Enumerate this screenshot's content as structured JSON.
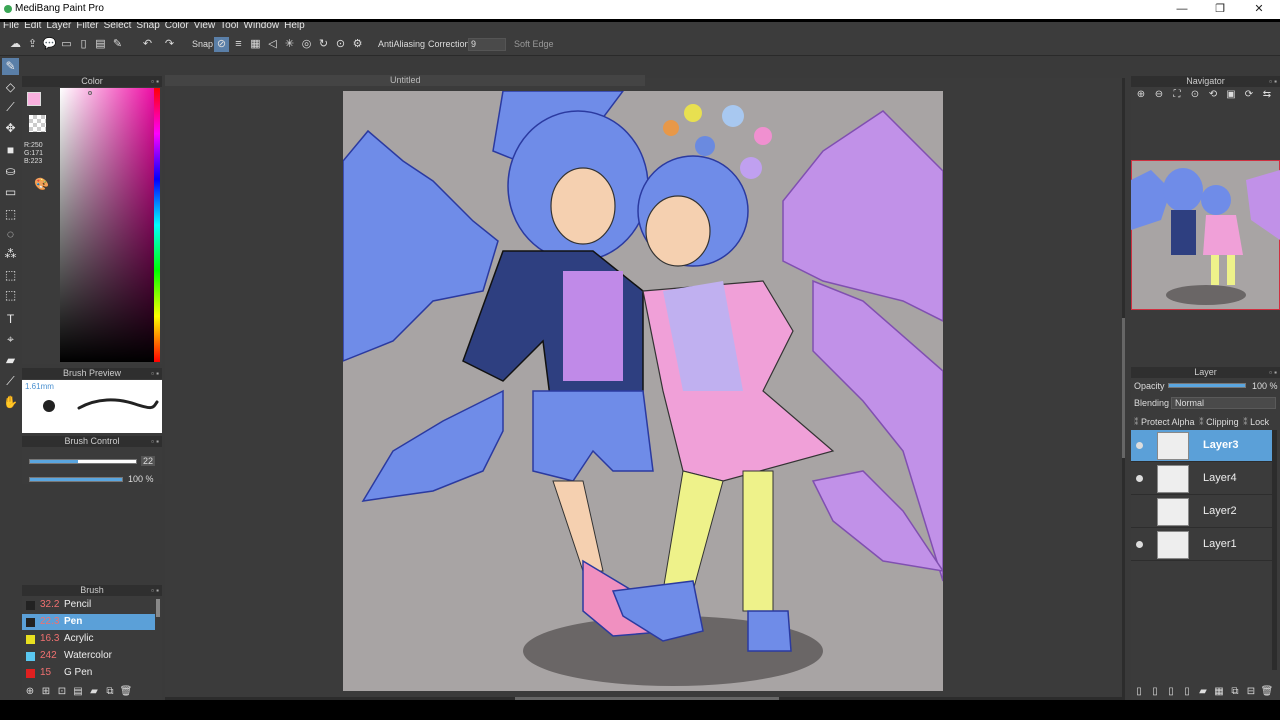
{
  "window": {
    "title": "MediBang Paint Pro",
    "minimize": "—",
    "maximize": "❐",
    "close": "✕"
  },
  "menu": [
    "File",
    "Edit",
    "Layer",
    "Filter",
    "Select",
    "Snap",
    "Color",
    "View",
    "Tool",
    "Window",
    "Help"
  ],
  "toolbar": {
    "snap_label": "Snap",
    "antialiasing_label": "AntiAliasing",
    "correction_label": "Correction",
    "correction_value": "9",
    "soft_edge_label": "Soft Edge"
  },
  "color_panel": {
    "title": "Color",
    "fg_color": "#fab0df",
    "r": "R:250",
    "g": "G:171",
    "b": "B:223"
  },
  "brush_preview": {
    "title": "Brush Preview",
    "size": "1.61mm"
  },
  "brush_control": {
    "title": "Brush Control",
    "size_value": "22",
    "size_fraction": 0.45,
    "opacity_value": "100 %",
    "opacity_fraction": 1.0
  },
  "brush_panel": {
    "title": "Brush",
    "items": [
      {
        "size": "32.2",
        "name": "Pencil",
        "color": "#222222",
        "selected": false
      },
      {
        "size": "22.3",
        "name": "Pen",
        "color": "#222222",
        "selected": true
      },
      {
        "size": "16.3",
        "name": "Acrylic",
        "color": "#e8e020",
        "selected": false
      },
      {
        "size": "242",
        "name": "Watercolor",
        "color": "#5ac8f0",
        "selected": false
      },
      {
        "size": "15",
        "name": "G Pen",
        "color": "#e02020",
        "selected": false
      }
    ]
  },
  "canvas": {
    "document_tab": "Untitled"
  },
  "navigator": {
    "title": "Navigator"
  },
  "layer_panel": {
    "title": "Layer",
    "opacity_label": "Opacity",
    "opacity_value": "100 %",
    "opacity_fraction": 1.0,
    "blending_label": "Blending",
    "blending_value": "Normal",
    "protect_alpha": "Protect Alpha",
    "clipping": "Clipping",
    "lock": "Lock",
    "layers": [
      {
        "name": "Layer3",
        "selected": true,
        "visible": true
      },
      {
        "name": "Layer4",
        "selected": false,
        "visible": true
      },
      {
        "name": "Layer2",
        "selected": false,
        "visible": false
      },
      {
        "name": "Layer1",
        "selected": false,
        "visible": true
      }
    ]
  }
}
